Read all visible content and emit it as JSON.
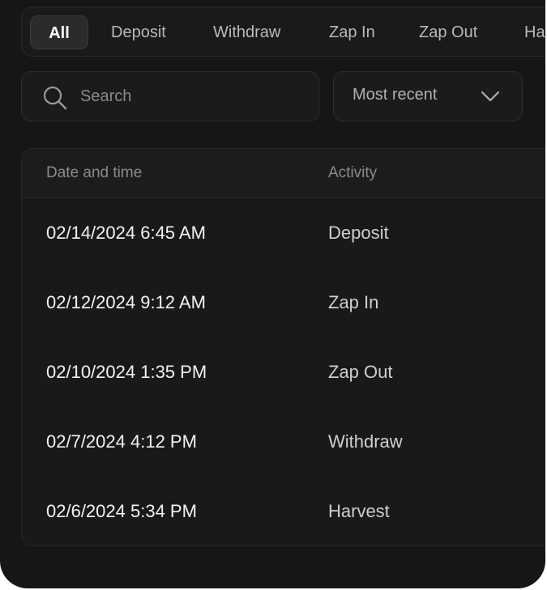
{
  "filters": {
    "tabs": [
      {
        "label": "All",
        "active": true
      },
      {
        "label": "Deposit",
        "active": false
      },
      {
        "label": "Withdraw",
        "active": false
      },
      {
        "label": "Zap In",
        "active": false
      },
      {
        "label": "Zap Out",
        "active": false
      },
      {
        "label": "Ha",
        "active": false
      }
    ]
  },
  "search": {
    "placeholder": "Search",
    "value": ""
  },
  "sort": {
    "selected": "Most recent"
  },
  "table": {
    "columns": [
      "Date and time",
      "Activity"
    ],
    "rows": [
      {
        "datetime": "02/14/2024 6:45 AM",
        "activity": "Deposit"
      },
      {
        "datetime": "02/12/2024 9:12 AM",
        "activity": "Zap In"
      },
      {
        "datetime": "02/10/2024 1:35 PM",
        "activity": "Zap Out"
      },
      {
        "datetime": "02/7/2024 4:12 PM",
        "activity": "Withdraw"
      },
      {
        "datetime": "02/6/2024 5:34 PM",
        "activity": "Harvest"
      }
    ]
  },
  "colors": {
    "panel_bg": "#161616",
    "active_tab_bg": "#2b2b2b",
    "text_primary": "#f2f2f2",
    "text_muted": "#8b8b8b"
  }
}
